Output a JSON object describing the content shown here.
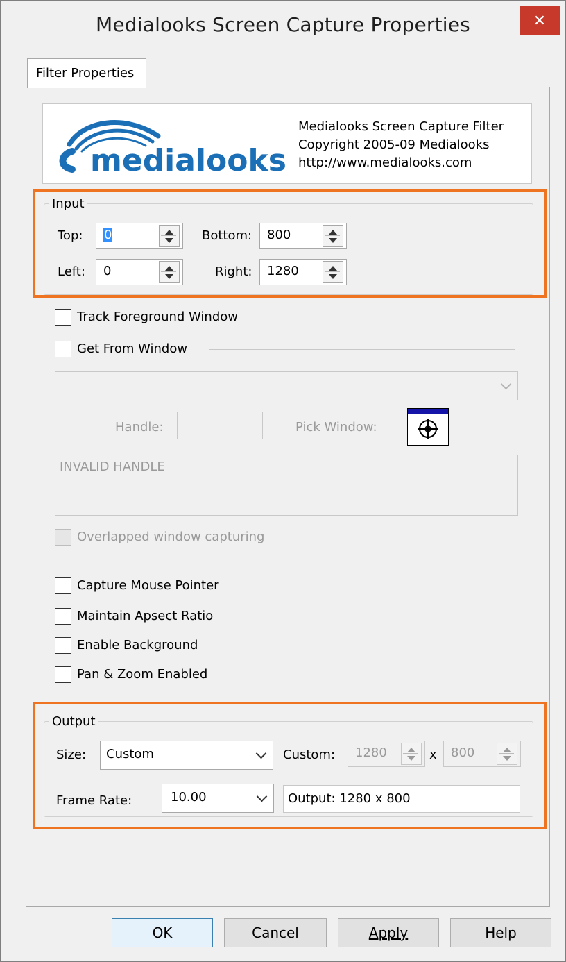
{
  "window": {
    "title": "Medialooks Screen Capture Properties",
    "close_glyph": "✕"
  },
  "tabs": [
    {
      "label": "Filter Properties"
    }
  ],
  "about": {
    "logo_text": "medialooks",
    "line1": "Medialooks Screen Capture Filter",
    "line2": "Copyright 2005-09 Medialooks",
    "line3": "http://www.medialooks.com"
  },
  "input": {
    "group_title": "Input",
    "top_label": "Top:",
    "top_value": "0",
    "bottom_label": "Bottom:",
    "bottom_value": "800",
    "left_label": "Left:",
    "left_value": "0",
    "right_label": "Right:",
    "right_value": "1280"
  },
  "options": {
    "track_foreground": {
      "label": "Track Foreground Window",
      "checked": false
    },
    "get_from_window": {
      "label": "Get From Window",
      "checked": false
    },
    "window_select": {
      "value": ""
    },
    "handle_label": "Handle:",
    "handle_value": "",
    "pick_window_label": "Pick Window:",
    "handle_status": "INVALID HANDLE",
    "overlapped": {
      "label": "Overlapped window capturing",
      "checked": false,
      "enabled": false
    },
    "capture_mouse": {
      "label": "Capture Mouse Pointer",
      "checked": false
    },
    "maintain_aspect": {
      "label": "Maintain Apsect Ratio",
      "checked": false
    },
    "enable_background": {
      "label": "Enable Background",
      "checked": false
    },
    "pan_zoom": {
      "label": "Pan & Zoom Enabled",
      "checked": false
    }
  },
  "output": {
    "group_title": "Output",
    "size_label": "Size:",
    "size_value": "Custom",
    "custom_label": "Custom:",
    "custom_width": "1280",
    "custom_x": "x",
    "custom_height": "800",
    "frame_rate_label": "Frame Rate:",
    "frame_rate_value": "10.00",
    "output_text": "Output: 1280 x 800"
  },
  "buttons": {
    "ok": "OK",
    "cancel": "Cancel",
    "apply": "Apply",
    "help": "Help"
  },
  "colors": {
    "highlight": "#ef7421",
    "logo_blue": "#1b6fb6",
    "close_red": "#c7392b"
  }
}
